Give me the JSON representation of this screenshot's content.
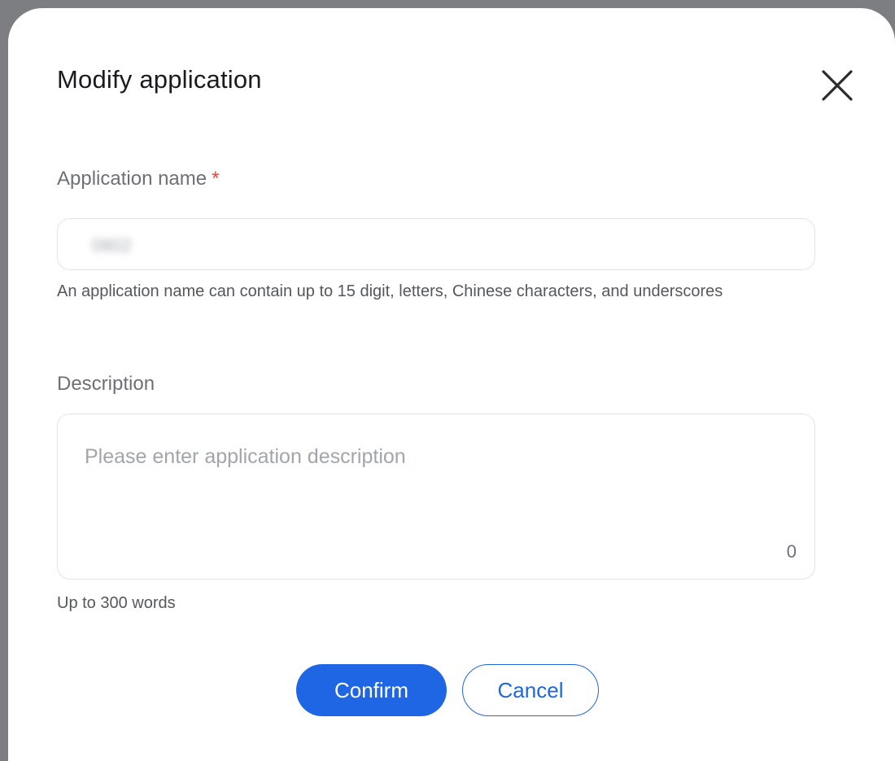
{
  "dialog": {
    "title": "Modify application",
    "close_icon": "close-icon"
  },
  "form": {
    "name_field": {
      "label": "Application name",
      "required_marker": "*",
      "value": "0802",
      "hint": "An application name can contain up to 15 digit, letters, Chinese characters, and underscores"
    },
    "description_field": {
      "label": "Description",
      "placeholder": "Please enter application description",
      "char_count": "0",
      "hint": "Up to 300 words"
    }
  },
  "actions": {
    "confirm_label": "Confirm",
    "cancel_label": "Cancel"
  },
  "colors": {
    "primary": "#1f66e5",
    "required": "#e2453d",
    "overlay": "#7d7e82"
  }
}
